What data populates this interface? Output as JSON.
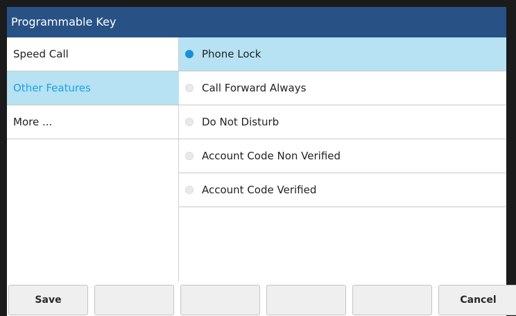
{
  "title": "Programmable Key",
  "left_menu": {
    "items": [
      {
        "label": "Speed Call",
        "selected": false
      },
      {
        "label": "Other Features",
        "selected": true
      },
      {
        "label": "More ...",
        "selected": false
      }
    ]
  },
  "options": {
    "items": [
      {
        "label": "Phone Lock",
        "selected": true
      },
      {
        "label": "Call Forward Always",
        "selected": false
      },
      {
        "label": "Do Not Disturb",
        "selected": false
      },
      {
        "label": "Account Code Non Verified",
        "selected": false
      },
      {
        "label": "Account Code Verified",
        "selected": false
      }
    ]
  },
  "softkeys": {
    "k1": "Save",
    "k2": "",
    "k3": "",
    "k4": "",
    "k5": "",
    "k6": "Cancel"
  },
  "colors": {
    "title_bar": "#285286",
    "selected_bg": "#b6e2f4",
    "selected_text": "#1da1e2",
    "radio_selected": "#1d8fd6"
  }
}
